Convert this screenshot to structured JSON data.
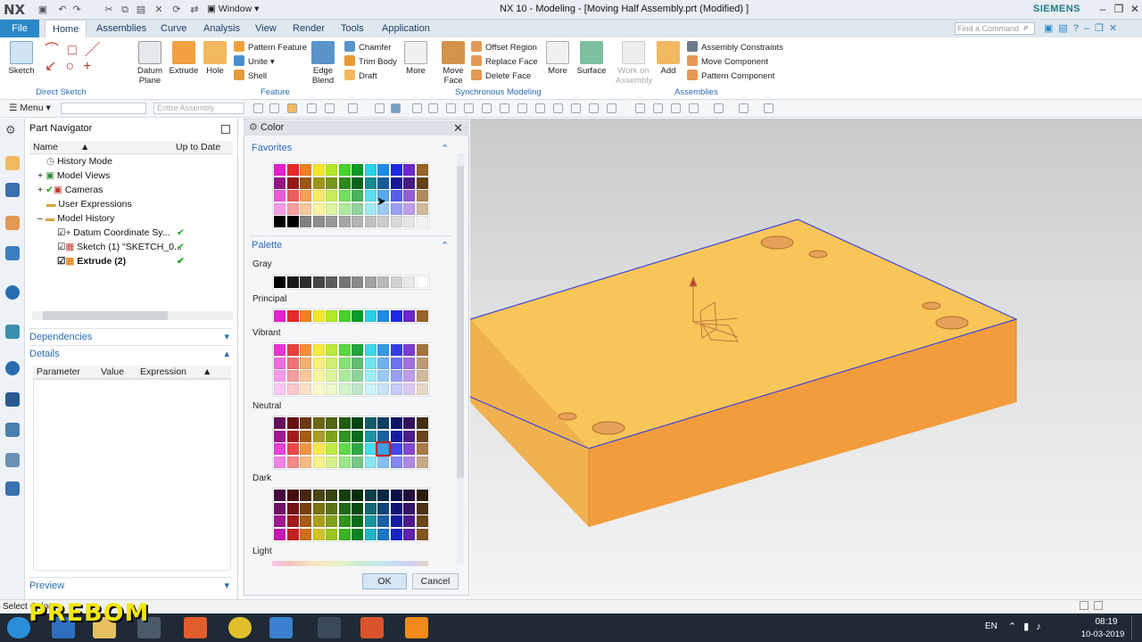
{
  "app": {
    "logo": "NX",
    "window_menu": "Window",
    "title": "NX 10 - Modeling - [Moving Half Assembly.prt (Modified) ]",
    "brand": "SIEMENS",
    "search_placeholder": "Find a Command"
  },
  "tabs": [
    "File",
    "Home",
    "Assemblies",
    "Curve",
    "Analysis",
    "View",
    "Render",
    "Tools",
    "Application"
  ],
  "active_tab": "Home",
  "ribbon": {
    "sketch": "Sketch",
    "datum_plane": "Datum Plane",
    "extrude": "Extrude",
    "hole": "Hole",
    "pattern_feature": "Pattern Feature",
    "unite": "Unite",
    "shell": "Shell",
    "edge_blend": "Edge Blend",
    "chamfer": "Chamfer",
    "trim_body": "Trim Body",
    "draft": "Draft",
    "more1": "More",
    "move_face": "Move Face",
    "offset_region": "Offset Region",
    "replace_face": "Replace Face",
    "delete_face": "Delete Face",
    "more2": "More",
    "surface": "Surface",
    "work_on_assembly": "Work on Assembly",
    "add": "Add",
    "assembly_constraints": "Assembly Constraints",
    "move_component": "Move Component",
    "pattern_component": "Pattern Component",
    "group_direct_sketch": "Direct Sketch",
    "group_feature": "Feature",
    "group_sync": "Synchronous Modeling",
    "group_assemblies": "Assemblies"
  },
  "toolbar": {
    "menu": "Menu",
    "filter_placeholder": "",
    "scope": "Entire Assembly"
  },
  "navigator": {
    "title": "Part Navigator",
    "col_name": "Name",
    "col_uptodate": "Up to Date",
    "items": [
      {
        "label": "History Mode",
        "bold": false,
        "check": false
      },
      {
        "label": "Model Views",
        "bold": false,
        "check": false
      },
      {
        "label": "Cameras",
        "bold": false,
        "check": false
      },
      {
        "label": "User Expressions",
        "bold": false,
        "check": false
      },
      {
        "label": "Model History",
        "bold": false,
        "check": false
      },
      {
        "label": "Datum Coordinate Sy...",
        "bold": false,
        "check": true
      },
      {
        "label": "Sketch (1) \"SKETCH_0...",
        "bold": false,
        "check": true
      },
      {
        "label": "Extrude (2)",
        "bold": true,
        "check": true
      }
    ],
    "dependencies": "Dependencies",
    "details": "Details",
    "details_cols": [
      "Parameter",
      "Value",
      "Expression"
    ],
    "preview": "Preview"
  },
  "color_dialog": {
    "title": "Color",
    "favorites": "Favorites",
    "palette": "Palette",
    "gray": "Gray",
    "principal": "Principal",
    "vibrant": "Vibrant",
    "neutral": "Neutral",
    "dark": "Dark",
    "light": "Light",
    "ok": "OK",
    "cancel": "Cancel",
    "selected_swatch": "neutral row 3 col 9"
  },
  "status": {
    "text": "Select Color"
  },
  "taskbar": {
    "language": "EN",
    "time": "08:19",
    "date": "10-03-2019"
  },
  "watermark": "PREBOM",
  "colors": {
    "accent": "#2b88c8",
    "part_top": "#f6c35a",
    "part_side": "#f0a445",
    "edge": "#3d46d8",
    "check": "#1aa51a"
  }
}
